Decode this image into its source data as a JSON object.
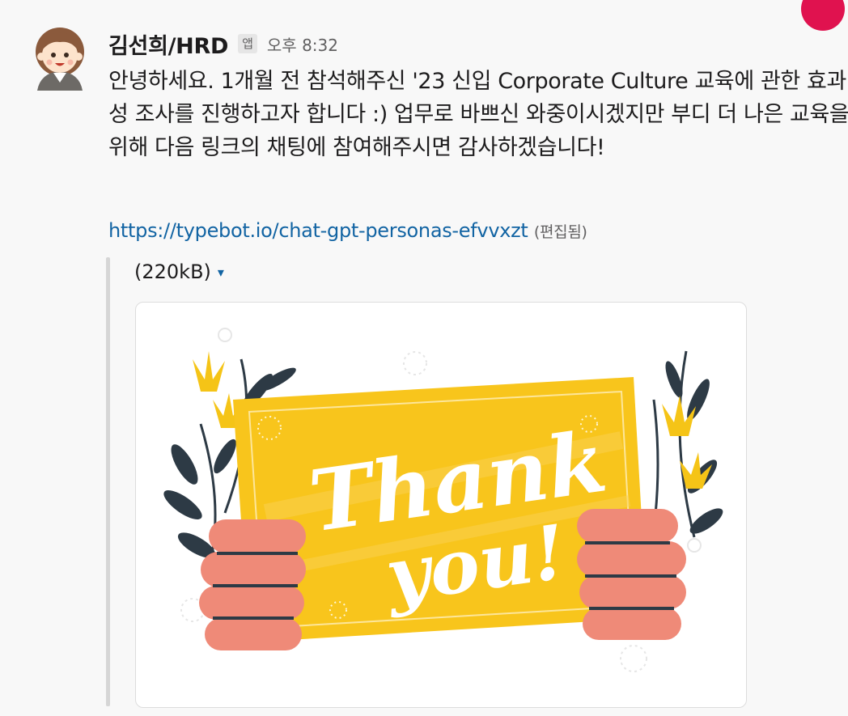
{
  "message": {
    "sender": "김선희/HRD",
    "app_badge": "앱",
    "time": "오후 8:32",
    "text": "안녕하세요. 1개월 전 참석해주신 '23 신입 Corporate Culture 교육에 관한 효과성 조사를 진행하고자 합니다 :) 업무로 바쁘신 와중이시겠지만 부디 더 나은 교육을 위해 다음 링크의 채팅에 참여해주시면 감사하겠습니다!",
    "link": "https://typebot.io/chat-gpt-personas-efvvxzt",
    "edited": "(편집됨)"
  },
  "attachment": {
    "size": "(220kB)",
    "caret_icon": "caret-down-icon",
    "image_text_line1": "Thank",
    "image_text_line2": "you!"
  },
  "colors": {
    "link": "#1264a3",
    "sign_yellow": "#f8c51c",
    "hand": "#ef8a78",
    "flower": "#f5c417",
    "leaf": "#2d3a45",
    "notification": "#e0124f"
  }
}
